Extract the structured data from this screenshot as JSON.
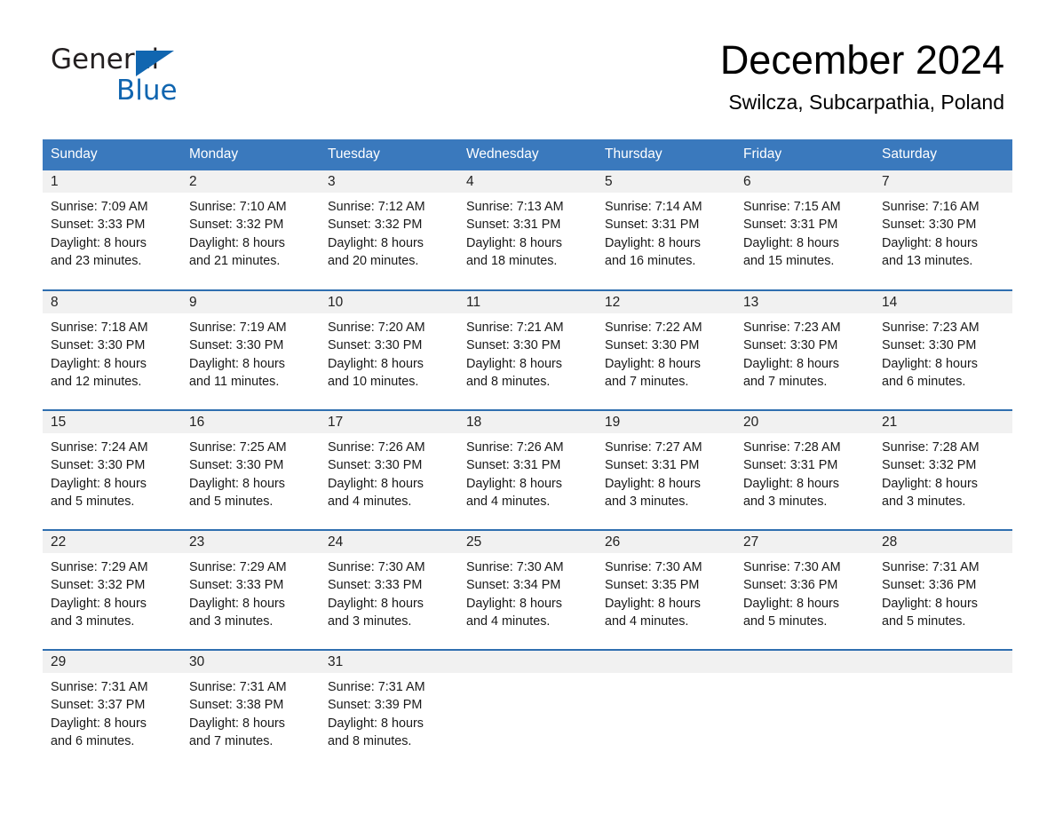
{
  "brand": {
    "name_part1": "General",
    "name_part2": "Blue",
    "logo_icon": "triangle-flag-icon",
    "accent_color": "#1166b0"
  },
  "header": {
    "month_title": "December 2024",
    "location": "Swilcza, Subcarpathia, Poland"
  },
  "calendar": {
    "header_bg": "#3a79bd",
    "daynum_bg": "#f1f1f1",
    "row_border_color": "#2f6fb0",
    "weekday_headers": [
      "Sunday",
      "Monday",
      "Tuesday",
      "Wednesday",
      "Thursday",
      "Friday",
      "Saturday"
    ],
    "weeks": [
      [
        {
          "day": "1",
          "sunrise": "Sunrise: 7:09 AM",
          "sunset": "Sunset: 3:33 PM",
          "daylight_line1": "Daylight: 8 hours",
          "daylight_line2": "and 23 minutes."
        },
        {
          "day": "2",
          "sunrise": "Sunrise: 7:10 AM",
          "sunset": "Sunset: 3:32 PM",
          "daylight_line1": "Daylight: 8 hours",
          "daylight_line2": "and 21 minutes."
        },
        {
          "day": "3",
          "sunrise": "Sunrise: 7:12 AM",
          "sunset": "Sunset: 3:32 PM",
          "daylight_line1": "Daylight: 8 hours",
          "daylight_line2": "and 20 minutes."
        },
        {
          "day": "4",
          "sunrise": "Sunrise: 7:13 AM",
          "sunset": "Sunset: 3:31 PM",
          "daylight_line1": "Daylight: 8 hours",
          "daylight_line2": "and 18 minutes."
        },
        {
          "day": "5",
          "sunrise": "Sunrise: 7:14 AM",
          "sunset": "Sunset: 3:31 PM",
          "daylight_line1": "Daylight: 8 hours",
          "daylight_line2": "and 16 minutes."
        },
        {
          "day": "6",
          "sunrise": "Sunrise: 7:15 AM",
          "sunset": "Sunset: 3:31 PM",
          "daylight_line1": "Daylight: 8 hours",
          "daylight_line2": "and 15 minutes."
        },
        {
          "day": "7",
          "sunrise": "Sunrise: 7:16 AM",
          "sunset": "Sunset: 3:30 PM",
          "daylight_line1": "Daylight: 8 hours",
          "daylight_line2": "and 13 minutes."
        }
      ],
      [
        {
          "day": "8",
          "sunrise": "Sunrise: 7:18 AM",
          "sunset": "Sunset: 3:30 PM",
          "daylight_line1": "Daylight: 8 hours",
          "daylight_line2": "and 12 minutes."
        },
        {
          "day": "9",
          "sunrise": "Sunrise: 7:19 AM",
          "sunset": "Sunset: 3:30 PM",
          "daylight_line1": "Daylight: 8 hours",
          "daylight_line2": "and 11 minutes."
        },
        {
          "day": "10",
          "sunrise": "Sunrise: 7:20 AM",
          "sunset": "Sunset: 3:30 PM",
          "daylight_line1": "Daylight: 8 hours",
          "daylight_line2": "and 10 minutes."
        },
        {
          "day": "11",
          "sunrise": "Sunrise: 7:21 AM",
          "sunset": "Sunset: 3:30 PM",
          "daylight_line1": "Daylight: 8 hours",
          "daylight_line2": "and 8 minutes."
        },
        {
          "day": "12",
          "sunrise": "Sunrise: 7:22 AM",
          "sunset": "Sunset: 3:30 PM",
          "daylight_line1": "Daylight: 8 hours",
          "daylight_line2": "and 7 minutes."
        },
        {
          "day": "13",
          "sunrise": "Sunrise: 7:23 AM",
          "sunset": "Sunset: 3:30 PM",
          "daylight_line1": "Daylight: 8 hours",
          "daylight_line2": "and 7 minutes."
        },
        {
          "day": "14",
          "sunrise": "Sunrise: 7:23 AM",
          "sunset": "Sunset: 3:30 PM",
          "daylight_line1": "Daylight: 8 hours",
          "daylight_line2": "and 6 minutes."
        }
      ],
      [
        {
          "day": "15",
          "sunrise": "Sunrise: 7:24 AM",
          "sunset": "Sunset: 3:30 PM",
          "daylight_line1": "Daylight: 8 hours",
          "daylight_line2": "and 5 minutes."
        },
        {
          "day": "16",
          "sunrise": "Sunrise: 7:25 AM",
          "sunset": "Sunset: 3:30 PM",
          "daylight_line1": "Daylight: 8 hours",
          "daylight_line2": "and 5 minutes."
        },
        {
          "day": "17",
          "sunrise": "Sunrise: 7:26 AM",
          "sunset": "Sunset: 3:30 PM",
          "daylight_line1": "Daylight: 8 hours",
          "daylight_line2": "and 4 minutes."
        },
        {
          "day": "18",
          "sunrise": "Sunrise: 7:26 AM",
          "sunset": "Sunset: 3:31 PM",
          "daylight_line1": "Daylight: 8 hours",
          "daylight_line2": "and 4 minutes."
        },
        {
          "day": "19",
          "sunrise": "Sunrise: 7:27 AM",
          "sunset": "Sunset: 3:31 PM",
          "daylight_line1": "Daylight: 8 hours",
          "daylight_line2": "and 3 minutes."
        },
        {
          "day": "20",
          "sunrise": "Sunrise: 7:28 AM",
          "sunset": "Sunset: 3:31 PM",
          "daylight_line1": "Daylight: 8 hours",
          "daylight_line2": "and 3 minutes."
        },
        {
          "day": "21",
          "sunrise": "Sunrise: 7:28 AM",
          "sunset": "Sunset: 3:32 PM",
          "daylight_line1": "Daylight: 8 hours",
          "daylight_line2": "and 3 minutes."
        }
      ],
      [
        {
          "day": "22",
          "sunrise": "Sunrise: 7:29 AM",
          "sunset": "Sunset: 3:32 PM",
          "daylight_line1": "Daylight: 8 hours",
          "daylight_line2": "and 3 minutes."
        },
        {
          "day": "23",
          "sunrise": "Sunrise: 7:29 AM",
          "sunset": "Sunset: 3:33 PM",
          "daylight_line1": "Daylight: 8 hours",
          "daylight_line2": "and 3 minutes."
        },
        {
          "day": "24",
          "sunrise": "Sunrise: 7:30 AM",
          "sunset": "Sunset: 3:33 PM",
          "daylight_line1": "Daylight: 8 hours",
          "daylight_line2": "and 3 minutes."
        },
        {
          "day": "25",
          "sunrise": "Sunrise: 7:30 AM",
          "sunset": "Sunset: 3:34 PM",
          "daylight_line1": "Daylight: 8 hours",
          "daylight_line2": "and 4 minutes."
        },
        {
          "day": "26",
          "sunrise": "Sunrise: 7:30 AM",
          "sunset": "Sunset: 3:35 PM",
          "daylight_line1": "Daylight: 8 hours",
          "daylight_line2": "and 4 minutes."
        },
        {
          "day": "27",
          "sunrise": "Sunrise: 7:30 AM",
          "sunset": "Sunset: 3:36 PM",
          "daylight_line1": "Daylight: 8 hours",
          "daylight_line2": "and 5 minutes."
        },
        {
          "day": "28",
          "sunrise": "Sunrise: 7:31 AM",
          "sunset": "Sunset: 3:36 PM",
          "daylight_line1": "Daylight: 8 hours",
          "daylight_line2": "and 5 minutes."
        }
      ],
      [
        {
          "day": "29",
          "sunrise": "Sunrise: 7:31 AM",
          "sunset": "Sunset: 3:37 PM",
          "daylight_line1": "Daylight: 8 hours",
          "daylight_line2": "and 6 minutes."
        },
        {
          "day": "30",
          "sunrise": "Sunrise: 7:31 AM",
          "sunset": "Sunset: 3:38 PM",
          "daylight_line1": "Daylight: 8 hours",
          "daylight_line2": "and 7 minutes."
        },
        {
          "day": "31",
          "sunrise": "Sunrise: 7:31 AM",
          "sunset": "Sunset: 3:39 PM",
          "daylight_line1": "Daylight: 8 hours",
          "daylight_line2": "and 8 minutes."
        },
        {
          "day": "",
          "sunrise": "",
          "sunset": "",
          "daylight_line1": "",
          "daylight_line2": ""
        },
        {
          "day": "",
          "sunrise": "",
          "sunset": "",
          "daylight_line1": "",
          "daylight_line2": ""
        },
        {
          "day": "",
          "sunrise": "",
          "sunset": "",
          "daylight_line1": "",
          "daylight_line2": ""
        },
        {
          "day": "",
          "sunrise": "",
          "sunset": "",
          "daylight_line1": "",
          "daylight_line2": ""
        }
      ]
    ]
  }
}
